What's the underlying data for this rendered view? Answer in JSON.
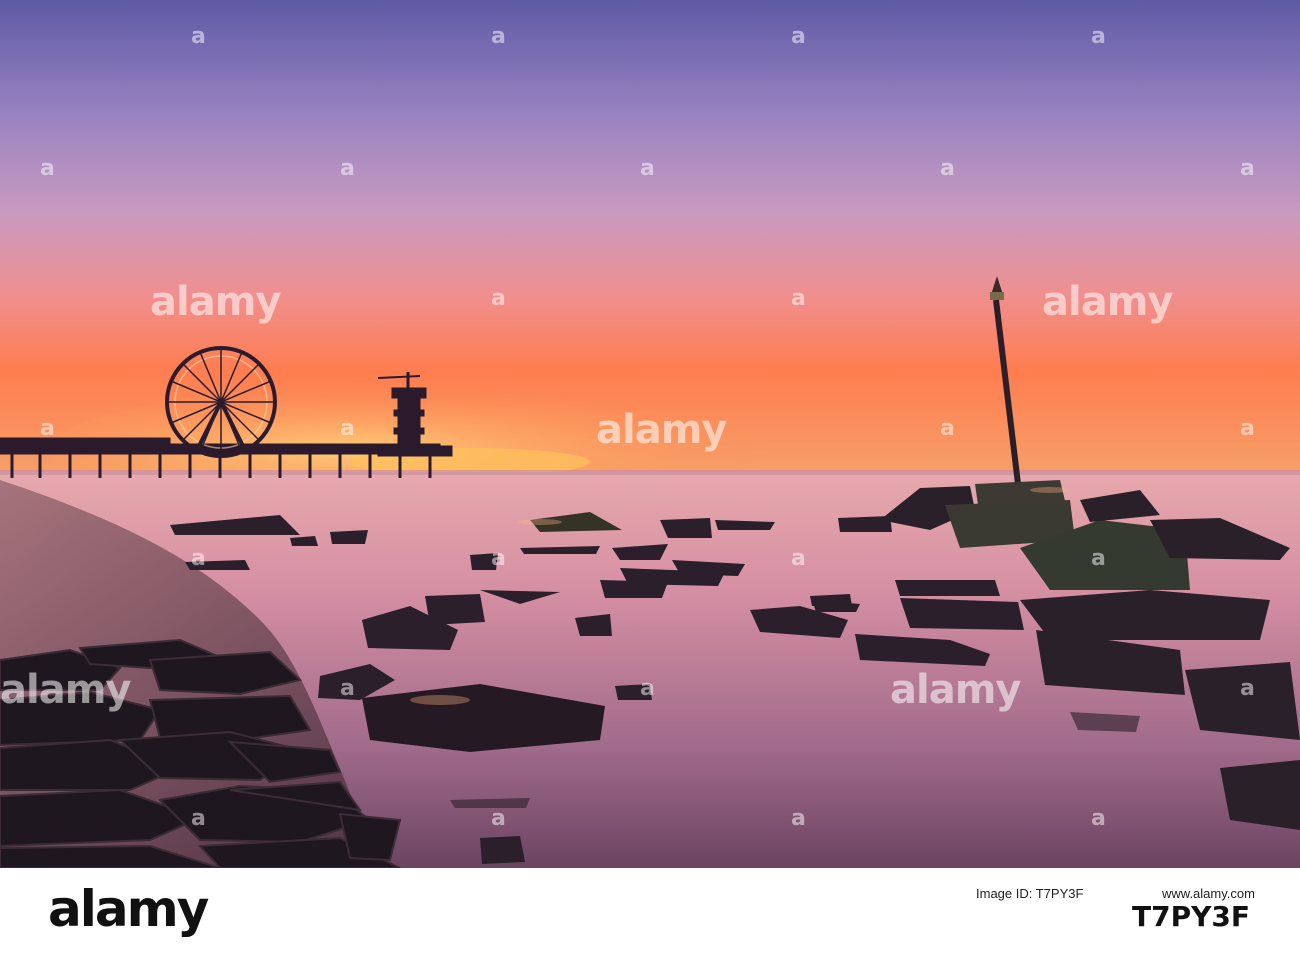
{
  "watermark": {
    "brand": "alamy",
    "letter": "a"
  },
  "footer": {
    "brand": "alamy",
    "image_id_label": "Image ID: T7PY3F",
    "site": "www.alamy.com",
    "code": "T7PY3F"
  },
  "colors": {
    "sky_top": "#6a5da6",
    "sky_mid": "#c98bb8",
    "horizon": "#ff7a4a",
    "water": "#d895a6",
    "rock": "#2a1f2a"
  },
  "icons": [
    "ferris-wheel-icon",
    "pier-icon",
    "tower-icon",
    "beacon-pole-icon"
  ]
}
